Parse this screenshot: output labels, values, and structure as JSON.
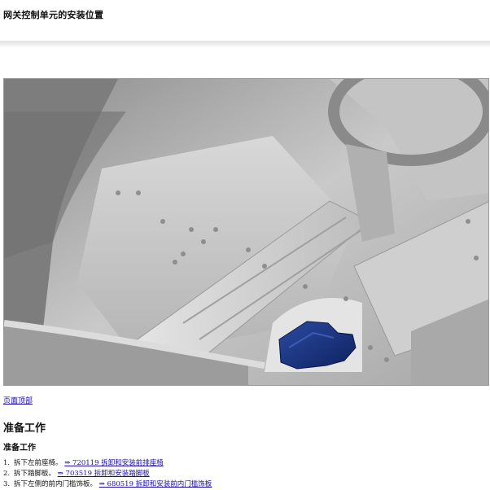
{
  "header": {
    "title": "网关控制单元的安装位置"
  },
  "nav": {
    "top_link": "页面顶部"
  },
  "section": {
    "title": "准备工作",
    "subtitle": "准备工作"
  },
  "steps": [
    {
      "num": "1.",
      "text": "拆下左前座椅。",
      "link": "⇒ 720119 拆卸和安装前排座椅"
    },
    {
      "num": "2.",
      "text": "拆下踏脚板。",
      "link": "⇒ 703519 拆卸和安装踏脚板"
    },
    {
      "num": "3.",
      "text": "拆下左侧的前内门槛饰板。",
      "link": "⇒ 680519 拆卸和安装前内门槛饰板"
    }
  ],
  "colors": {
    "highlight": "#15307a",
    "link": "#1a0dab"
  }
}
